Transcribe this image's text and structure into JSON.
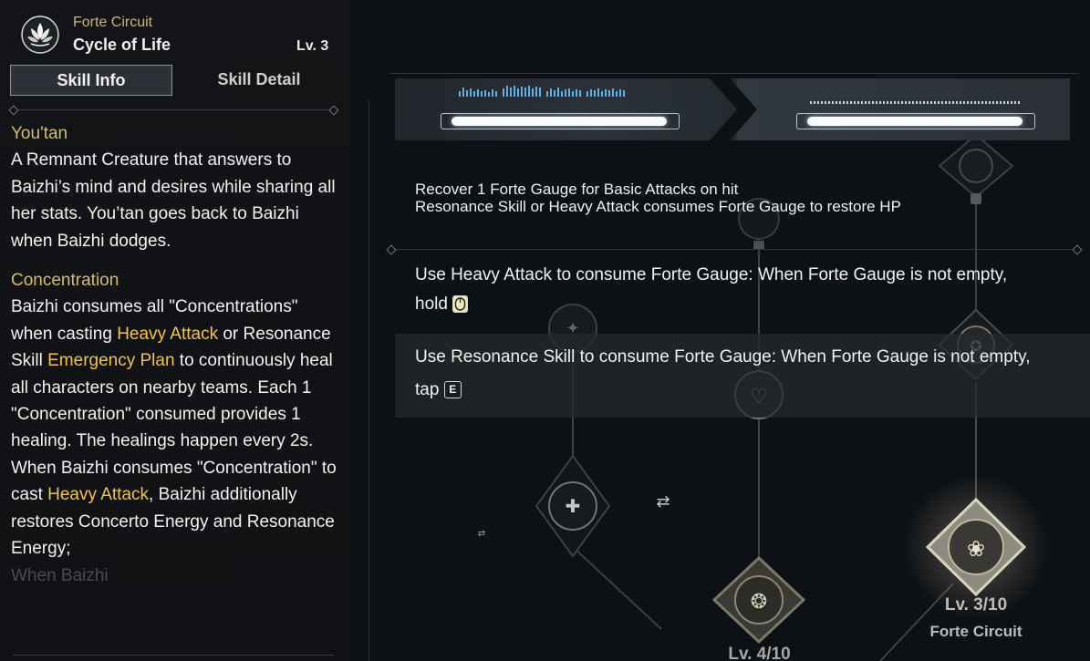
{
  "header": {
    "subtitle": "Forte Circuit",
    "title": "Cycle of Life",
    "level": "Lv. 3",
    "icon": "lotus-icon"
  },
  "tabs": [
    {
      "label": "Skill Info",
      "active": true
    },
    {
      "label": "Skill Detail",
      "active": false
    }
  ],
  "sections": {
    "youtan": {
      "heading": "You'tan",
      "body": "A Remnant Creature that answers to Baizhi’s mind and desires while sharing all her stats. You’tan goes back to Baizhi when Baizhi dodges."
    },
    "concentration": {
      "heading": "Concentration",
      "p1_a": "Baizhi consumes all \"Concentrations\" when casting ",
      "p1_hl1": "Heavy Attack",
      "p1_b": " or Resonance Skill ",
      "p1_hl2": "Emergency Plan",
      "p1_c": " to continuously heal all characters on nearby teams. Each 1 \"Concentration\" consumed provides 1 healing. The healings happen every 2s.",
      "p2_a": "When Baizhi consumes \"Concentration\" to cast ",
      "p2_hl": "Heavy Attack",
      "p2_b": ", Baizhi additionally restores Concerto Energy and Resonance Energy;",
      "p3_fade": "When Baizhi"
    }
  },
  "tips": {
    "line1": "Recover 1 Forte Gauge for Basic Attacks on hit",
    "line2": "Resonance Skill or Heavy Attack consumes Forte Gauge to restore HP",
    "heavy_text": "Use Heavy Attack to consume Forte Gauge: When Forte Gauge is not empty,",
    "heavy_action": "hold",
    "heavy_key_icon": "mouse-icon",
    "skill_text": "Use Resonance Skill to consume Forte Gauge: When Forte Gauge is not empty,",
    "skill_action": "tap",
    "skill_key": "E"
  },
  "nodes": {
    "forte_level": "Lv. 3/10",
    "forte_label": "Forte Circuit",
    "lower_level": "Lv. 4/10"
  },
  "colors": {
    "gold": "#d8bb6b",
    "highlight": "#f4c543",
    "gauge_blue": "#5fb0e8"
  }
}
